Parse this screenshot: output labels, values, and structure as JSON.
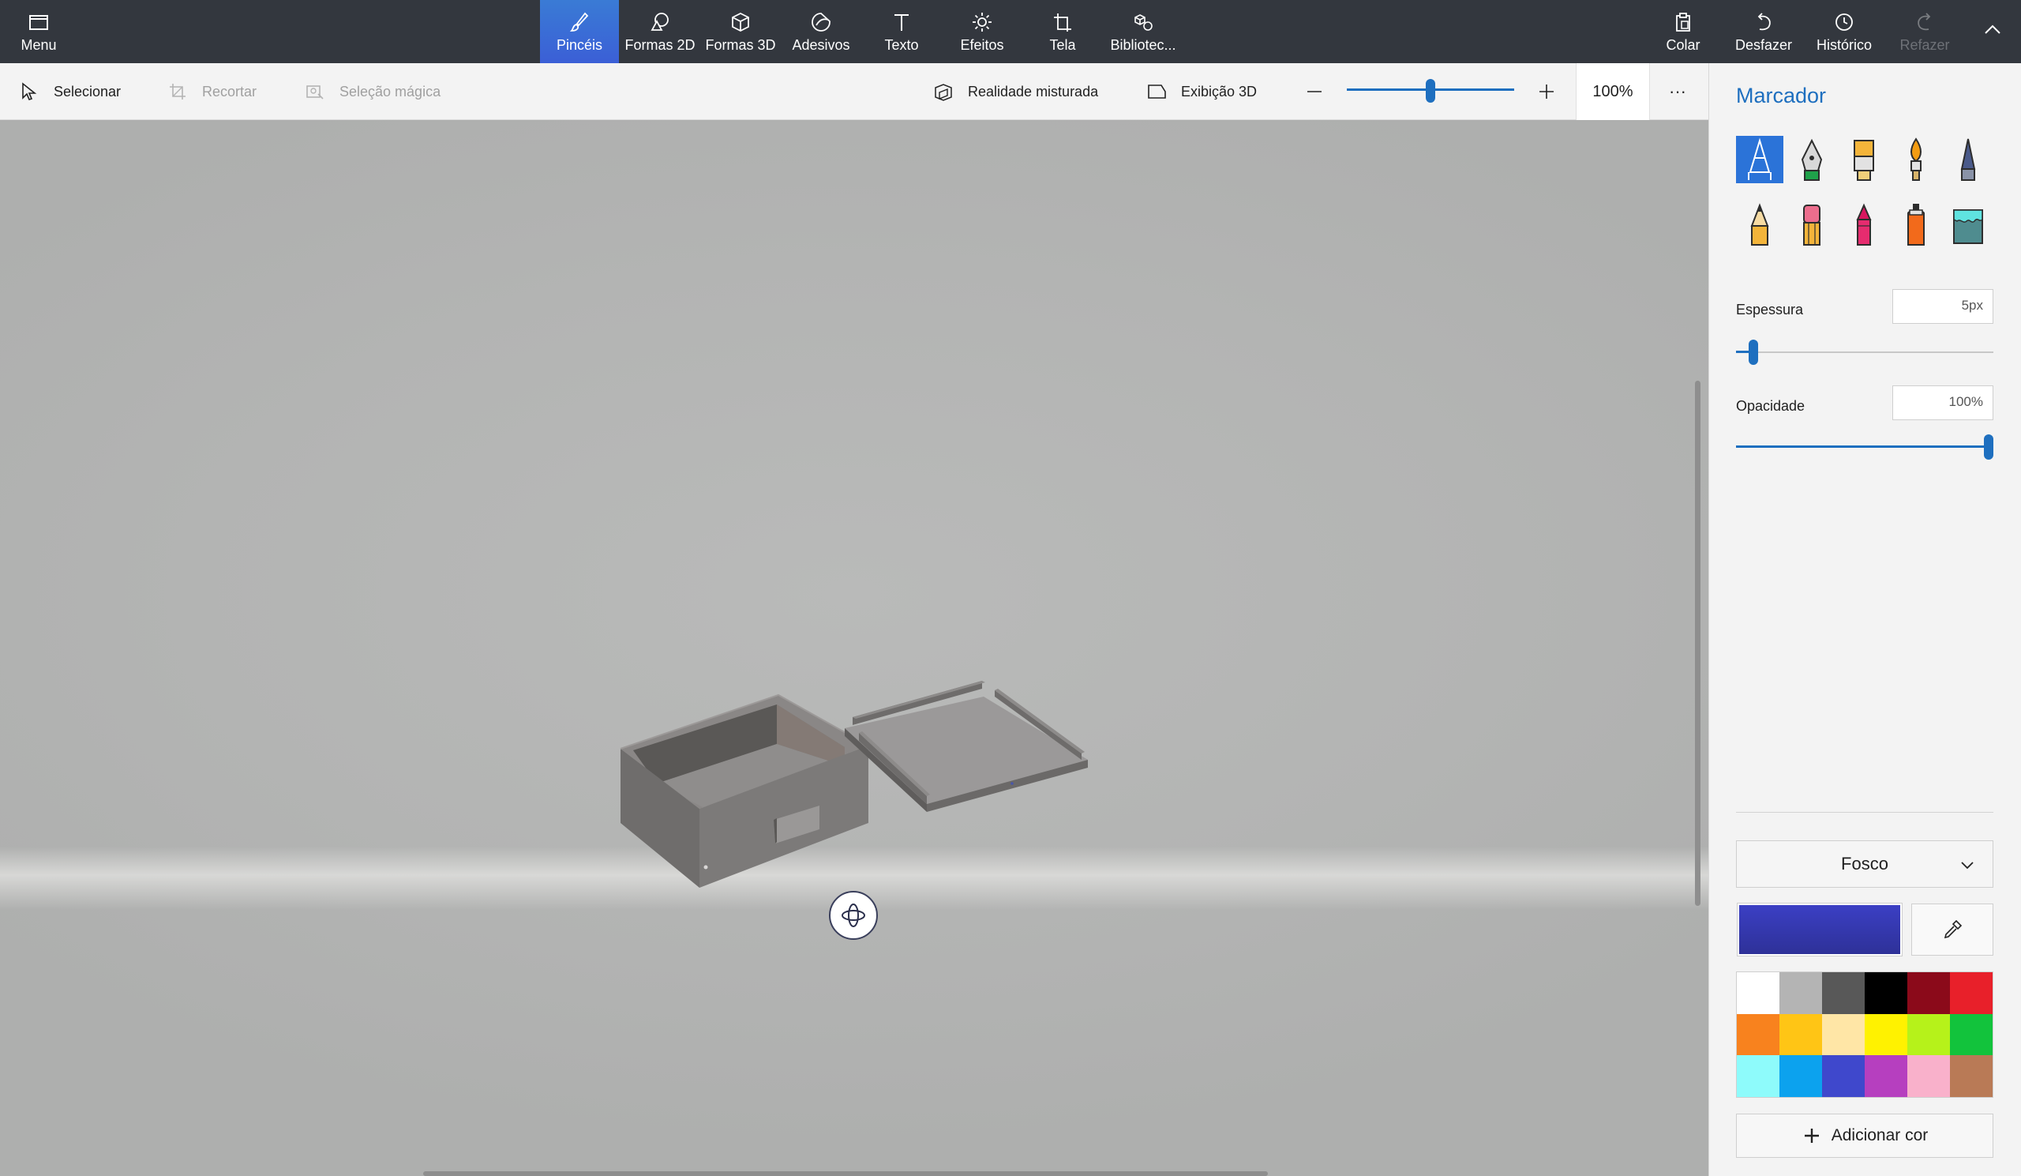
{
  "topbar": {
    "menu_label": "Menu",
    "tools": [
      {
        "label": "Pincéis",
        "icon": "brush-icon",
        "active": true
      },
      {
        "label": "Formas 2D",
        "icon": "shapes-2d-icon"
      },
      {
        "label": "Formas 3D",
        "icon": "cube-icon"
      },
      {
        "label": "Adesivos",
        "icon": "sticker-icon"
      },
      {
        "label": "Texto",
        "icon": "text-icon"
      },
      {
        "label": "Efeitos",
        "icon": "sun-icon"
      },
      {
        "label": "Tela",
        "icon": "canvas-crop-icon"
      },
      {
        "label": "Bibliotec...",
        "icon": "library-icon"
      }
    ],
    "actions": [
      {
        "label": "Colar",
        "icon": "paste-icon",
        "enabled": true
      },
      {
        "label": "Desfazer",
        "icon": "undo-icon",
        "enabled": true
      },
      {
        "label": "Histórico",
        "icon": "history-icon",
        "enabled": true
      },
      {
        "label": "Refazer",
        "icon": "redo-icon",
        "enabled": false
      }
    ],
    "collapse_icon": "chevron-up-icon"
  },
  "toolbar": {
    "select_label": "Selecionar",
    "crop_label": "Recortar",
    "magic_select_label": "Seleção mágica",
    "mixed_reality_label": "Realidade misturada",
    "view3d_label": "Exibição 3D",
    "zoom_value": "100%",
    "zoom_slider_fraction": 0.5,
    "more_label": "···"
  },
  "panel": {
    "title": "Marcador",
    "brushes": [
      {
        "name": "marker",
        "icon": "marker-icon",
        "selected": true
      },
      {
        "name": "calligraphy-pen",
        "icon": "calligraphy-pen-icon"
      },
      {
        "name": "oil-brush",
        "icon": "oil-brush-icon"
      },
      {
        "name": "watercolor",
        "icon": "watercolor-brush-icon"
      },
      {
        "name": "pixel-pen",
        "icon": "pixel-pen-icon"
      },
      {
        "name": "pencil",
        "icon": "pencil-icon"
      },
      {
        "name": "eraser",
        "icon": "eraser-icon"
      },
      {
        "name": "crayon",
        "icon": "crayon-icon"
      },
      {
        "name": "spray-can",
        "icon": "spray-can-icon"
      },
      {
        "name": "fill",
        "icon": "fill-bucket-icon"
      }
    ],
    "thickness_label": "Espessura",
    "thickness_value": "5px",
    "thickness_fraction": 0.05,
    "opacity_label": "Opacidade",
    "opacity_value": "100%",
    "opacity_fraction": 1.0,
    "finish_value": "Fosco",
    "current_color": "#3b3fc4",
    "palette": [
      "#ffffff",
      "#b4b4b4",
      "#585858",
      "#000000",
      "#8b0a1a",
      "#e8202a",
      "#f8821e",
      "#ffc515",
      "#ffe6a6",
      "#fff200",
      "#b6f21a",
      "#12c33c",
      "#8efbfb",
      "#0ca2ee",
      "#3f48cc",
      "#b63fbf",
      "#f9b1cb",
      "#b97a56"
    ],
    "add_color_label": "Adicionar cor"
  }
}
